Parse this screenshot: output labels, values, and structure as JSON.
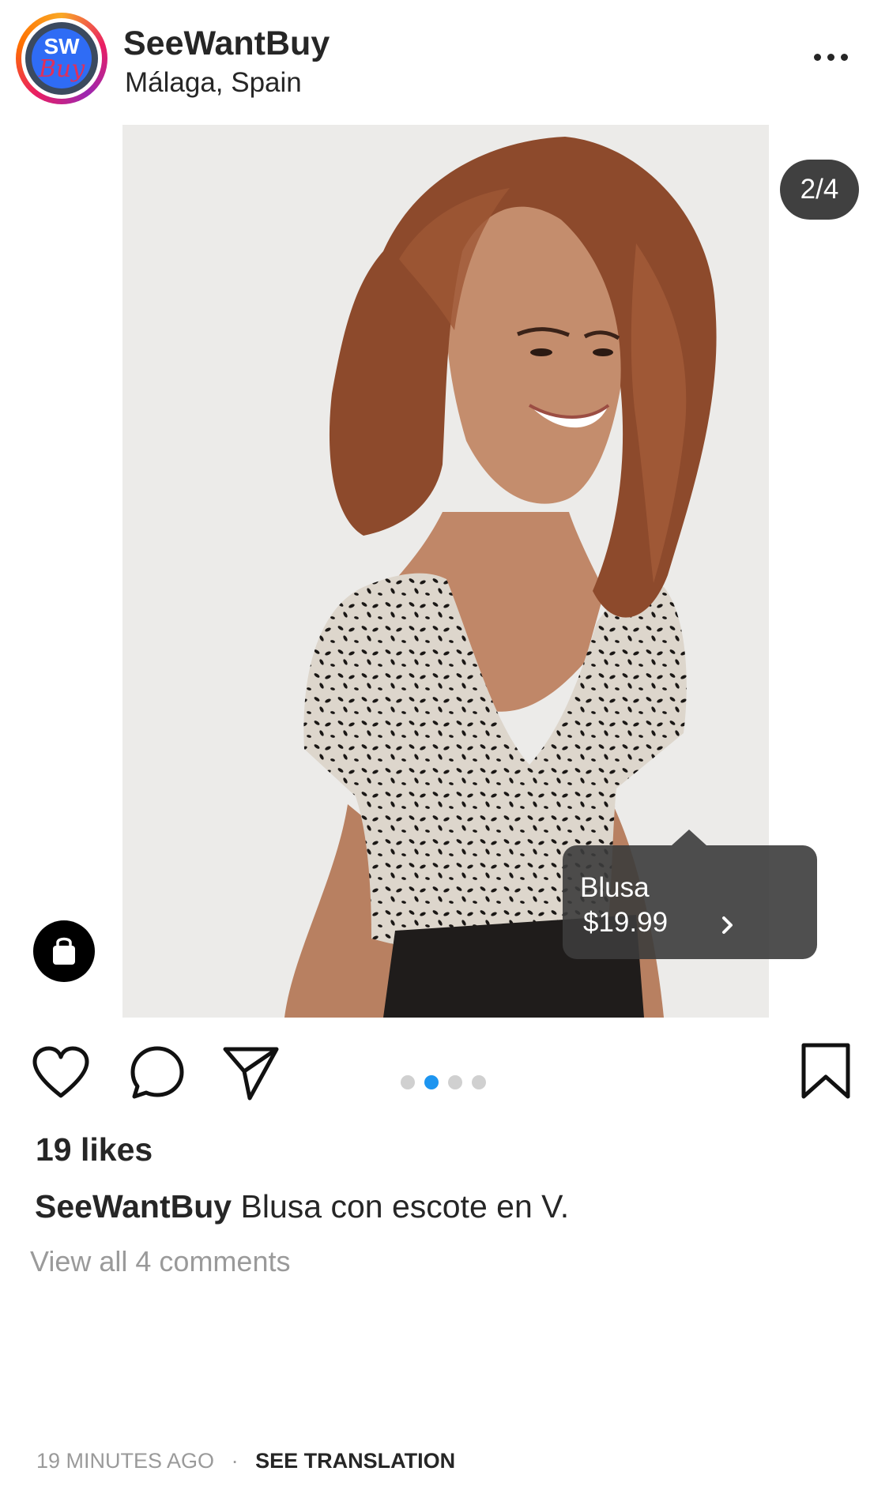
{
  "post": {
    "account": {
      "username": "SeeWantBuy",
      "location": "Málaga, Spain",
      "avatar": {
        "line1": "SW",
        "line2": "Buy"
      }
    },
    "media": {
      "counter": "2/4",
      "active_dot": 2,
      "total_dots": 4,
      "product_tag": {
        "name": "Blusa",
        "price": "$19.99"
      }
    },
    "likes": "19 likes",
    "caption": {
      "username": "SeeWantBuy",
      "text": "Blusa con escote en V."
    },
    "comments_link": "View all 4 comments",
    "timestamp": "19 MINUTES AGO",
    "separator": "·",
    "translation_link": "SEE TRANSLATION"
  },
  "icons": [
    "more-icon",
    "shopping-bag-icon",
    "heart-icon",
    "comment-icon",
    "share-icon",
    "bookmark-icon",
    "chevron-right-icon"
  ],
  "colors": {
    "active_dot": "#1d95f0",
    "inactive_dot": "#d0d0d0",
    "text_primary": "#262626",
    "text_secondary": "#9a9a9a"
  }
}
